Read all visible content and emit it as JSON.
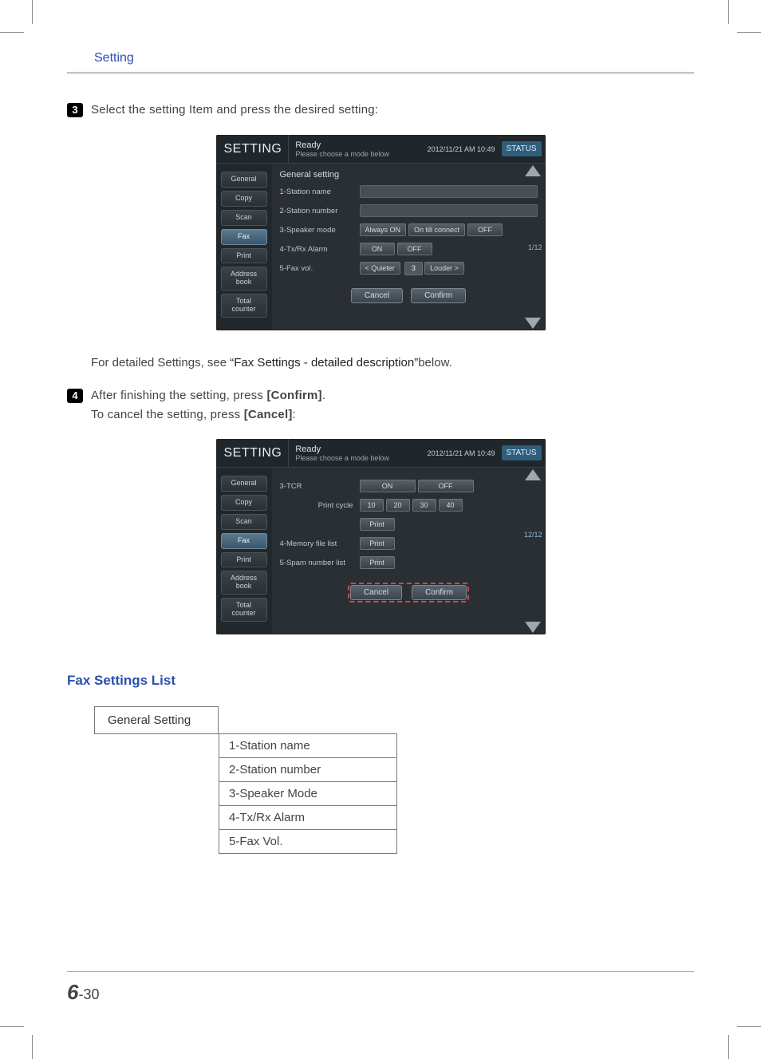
{
  "header": {
    "section": "Setting"
  },
  "steps": {
    "s3": {
      "num": "3",
      "text": "Select the setting Item and press the desired setting:"
    },
    "note": {
      "prefix": "For detailed Settings, see  ",
      "link": "“Fax Settings - detailed description”",
      "suffix": "below."
    },
    "s4": {
      "num": "4",
      "line1_a": "After finishing the setting, press ",
      "line1_b": "[Confirm]",
      "line1_c": ".",
      "line2_a": "To cancel the setting, press ",
      "line2_b": "[Cancel]",
      "line2_c": ":"
    }
  },
  "device_common": {
    "title": "SETTING",
    "ready": "Ready",
    "subtitle": "Please choose a mode below",
    "datetime": "2012/11/21 AM 10:49",
    "status_btn": "STATUS",
    "sidebar": [
      "General",
      "Copy",
      "Scan",
      "Fax",
      "Print",
      "Address\nbook",
      "Total\ncounter"
    ],
    "cancel": "Cancel",
    "confirm": "Confirm"
  },
  "device1": {
    "panel_title": "General setting",
    "page_ind": "1/12",
    "rows": {
      "r1": "1-Station name",
      "r2": "2-Station number",
      "r3": "3-Speaker mode",
      "r3_opts": [
        "Always ON",
        "On till connect",
        "OFF"
      ],
      "r4": "4-Tx/Rx Alarm",
      "r4_opts": [
        "ON",
        "OFF"
      ],
      "r5": "5-Fax vol.",
      "r5_quiet": "< Quieter",
      "r5_val": "3",
      "r5_loud": "Louder >"
    }
  },
  "device2": {
    "page_ind": "12/12",
    "rows": {
      "r3": "3-TCR",
      "r3_opts": [
        "ON",
        "OFF"
      ],
      "pc_label": "Print cycle",
      "pc_opts": [
        "10",
        "20",
        "30",
        "40"
      ],
      "pc_print": "Print",
      "r4": "4-Memory file list",
      "r4_btn": "Print",
      "r5": "5-Spam number list",
      "r5_btn": "Print"
    }
  },
  "subheading": "Fax Settings List",
  "tree": {
    "header": "General Setting",
    "items": [
      "1-Station name",
      "2-Station number",
      "3-Speaker Mode",
      "4-Tx/Rx Alarm",
      "5-Fax Vol."
    ]
  },
  "footer": {
    "chapter": "6",
    "sep": "-",
    "page": "30"
  }
}
